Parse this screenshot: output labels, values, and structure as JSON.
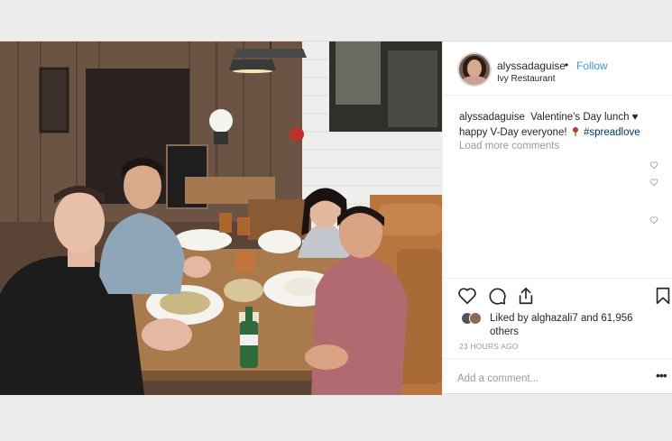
{
  "post": {
    "author": {
      "username": "alyssadaguise",
      "follow_separator": "•",
      "follow_label": "Follow",
      "location": "Ivy Restaurant"
    },
    "caption": {
      "username": "alyssadaguise",
      "text_before": "Valentine's Day lunch ♥ happy V-Day everyone!",
      "hashtag": "#spreadlove"
    },
    "load_more_label": "Load more comments",
    "likes": {
      "text": "Liked by alghazali7 and 61,956 others"
    },
    "timestamp": "23 HOURS AGO",
    "comment": {
      "placeholder": "Add a comment...",
      "more_label": "•••"
    },
    "icons": {
      "like": "heart-icon",
      "comment": "comment-icon",
      "share": "share-icon",
      "save": "bookmark-icon",
      "comment_like": "heart-icon",
      "location_rose": "rose-icon"
    },
    "colors": {
      "follow": "#3897f0",
      "hashtag": "#003569",
      "muted": "#999999",
      "text": "#262626"
    }
  }
}
